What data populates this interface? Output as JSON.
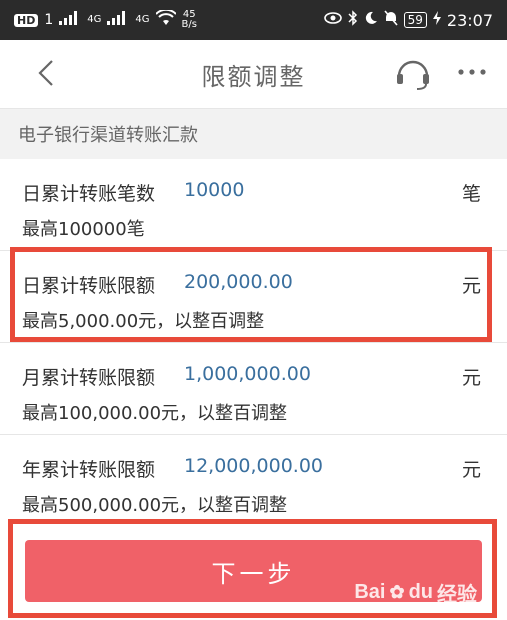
{
  "status_bar": {
    "hd_badge": "HD",
    "sim1": "1",
    "net1": "4G",
    "net2": "4G",
    "speed_top": "45",
    "speed_unit": "B/s",
    "battery": "59",
    "time": "23:07"
  },
  "nav": {
    "title": "限额调整",
    "back_icon": "chevron-left-icon",
    "service_icon": "headset-icon",
    "more_icon": "more-dots-icon"
  },
  "section": {
    "title": "电子银行渠道转账汇款"
  },
  "limits": [
    {
      "label": "日累计转账笔数",
      "value": "10000",
      "unit": "笔",
      "hint": "最高100000笔"
    },
    {
      "label": "日累计转账限额",
      "value": "200,000.00",
      "unit": "元",
      "hint": "最高5,000.00元，以整百调整"
    },
    {
      "label": "月累计转账限额",
      "value": "1,000,000.00",
      "unit": "元",
      "hint": "最高100,000.00元，以整百调整"
    },
    {
      "label": "年累计转账限额",
      "value": "12,000,000.00",
      "unit": "元",
      "hint": "最高500,000.00元，以整百调整"
    }
  ],
  "actions": {
    "next_label": "下一步"
  },
  "watermark": {
    "brand": "Bai",
    "brand2": "du",
    "suffix": "经验"
  },
  "colors": {
    "accent_button": "#f06168",
    "highlight": "#e84a3a",
    "value_text": "#3a6f9e"
  }
}
